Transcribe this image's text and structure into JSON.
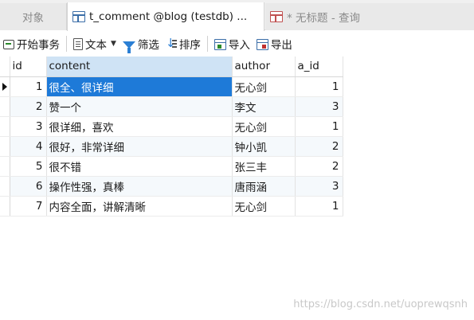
{
  "tabs": [
    {
      "label": "对象",
      "active": false
    },
    {
      "label": "t_comment @blog (testdb) ...",
      "active": true
    },
    {
      "label": "* 无标题 - 查询",
      "active": false
    }
  ],
  "toolbar": {
    "begin_txn": "开始事务",
    "text": "文本",
    "filter": "筛选",
    "sort": "排序",
    "import": "导入",
    "export": "导出"
  },
  "grid": {
    "columns": [
      "id",
      "content",
      "author",
      "a_id"
    ],
    "rows": [
      {
        "id": "1",
        "content": "很全、很详细",
        "author": "无心剑",
        "a_id": "1"
      },
      {
        "id": "2",
        "content": "赞一个",
        "author": "李文",
        "a_id": "3"
      },
      {
        "id": "3",
        "content": "很详细，喜欢",
        "author": "无心剑",
        "a_id": "1"
      },
      {
        "id": "4",
        "content": "很好，非常详细",
        "author": "钟小凯",
        "a_id": "2"
      },
      {
        "id": "5",
        "content": "很不错",
        "author": "张三丰",
        "a_id": "2"
      },
      {
        "id": "6",
        "content": "操作性强，真棒",
        "author": "唐雨涵",
        "a_id": "3"
      },
      {
        "id": "7",
        "content": "内容全面，讲解清晰",
        "author": "无心剑",
        "a_id": "1"
      }
    ]
  },
  "watermark": "https://blog.csdn.net/uoprewqsnh",
  "colors": {
    "selection": "#1e7ad8",
    "header_selected": "#cfe3f5",
    "accent": "#2b7fd4"
  }
}
